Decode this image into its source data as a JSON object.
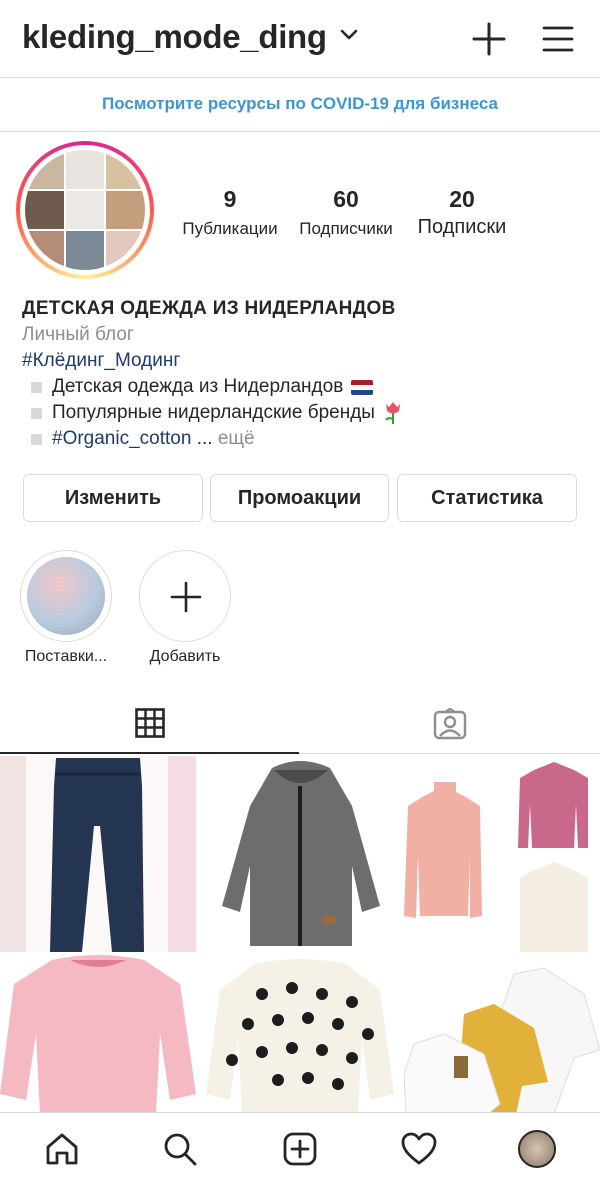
{
  "header": {
    "username": "kleding_mode_ding"
  },
  "covid_banner": "Посмотрите ресурсы по COVID-19 для бизнеса",
  "stats": [
    {
      "value": "9",
      "label": "Публикации"
    },
    {
      "value": "60",
      "label": "Подписчики"
    },
    {
      "value": "20",
      "label": "Подписки"
    }
  ],
  "bio": {
    "name": "ДЕТСКАЯ ОДЕЖДА ИЗ НИДЕРЛАНДОВ",
    "category": "Личный блог",
    "hashtag": "#Клёдинг_Модинг",
    "lines": [
      "Детская одежда из Нидерландов",
      "Популярные нидерландские бренды"
    ],
    "line3_tag": "#Organic_cotton",
    "line3_ellipsis": " ... ",
    "more": "ещё"
  },
  "buttons": {
    "edit": "Изменить",
    "promo": "Промоакции",
    "stats": "Статистика"
  },
  "highlights": [
    {
      "label": "Поставки..."
    },
    {
      "label": "Добавить"
    }
  ],
  "colors": {
    "link": "#3e95d6",
    "hashtag": "#1f3a6b",
    "muted": "#8e8e8e",
    "border": "#dbdbdb"
  }
}
